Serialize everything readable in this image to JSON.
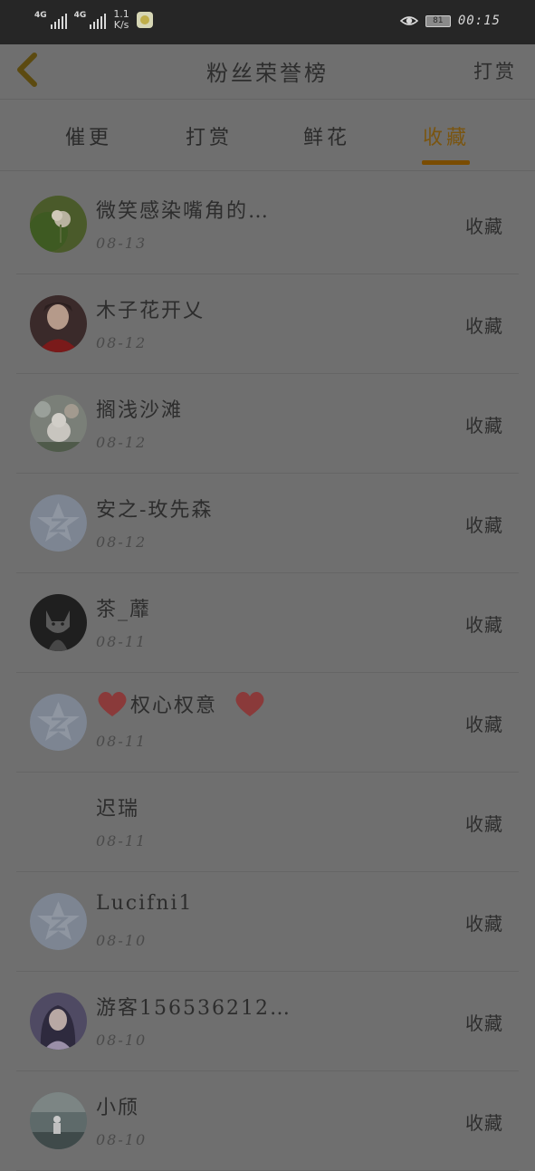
{
  "status_bar": {
    "network1": "4G",
    "network2": "4G",
    "speed_value": "1.1",
    "speed_unit": "K/s",
    "battery": "81",
    "time": "00:15"
  },
  "header": {
    "title": "粉丝荣誉榜",
    "right_action": "打赏"
  },
  "tabs": [
    {
      "label": "催更",
      "active": false
    },
    {
      "label": "打赏",
      "active": false
    },
    {
      "label": "鲜花",
      "active": false
    },
    {
      "label": "收藏",
      "active": true
    }
  ],
  "items": [
    {
      "name": "微笑感染嘴角的…",
      "date": "08-13",
      "action": "收藏",
      "avatar": "photo-flower"
    },
    {
      "name": "木子花开乂",
      "date": "08-12",
      "action": "收藏",
      "avatar": "photo-girl-red"
    },
    {
      "name": "搁浅沙滩",
      "date": "08-12",
      "action": "收藏",
      "avatar": "photo-cat-flowers"
    },
    {
      "name": "安之-玫先森",
      "date": "08-12",
      "action": "收藏",
      "avatar": "default-star"
    },
    {
      "name": "茶_蘼",
      "date": "08-11",
      "action": "收藏",
      "avatar": "photo-wolf"
    },
    {
      "name": "权心权意",
      "date": "08-11",
      "action": "收藏",
      "avatar": "default-star"
    },
    {
      "name": "迟瑞",
      "date": "08-11",
      "action": "收藏",
      "avatar": "none"
    },
    {
      "name": "Lucifni1",
      "date": "08-10",
      "action": "收藏",
      "avatar": "default-star"
    },
    {
      "name": "游客156536212…",
      "date": "08-10",
      "action": "收藏",
      "avatar": "photo-woman-purple"
    },
    {
      "name": "小颀",
      "date": "08-10",
      "action": "收藏",
      "avatar": "photo-person-lake"
    }
  ],
  "colors": {
    "accent": "#7a4c00",
    "back_arrow": "#5c4a10",
    "heart": "#8a3a3a"
  }
}
